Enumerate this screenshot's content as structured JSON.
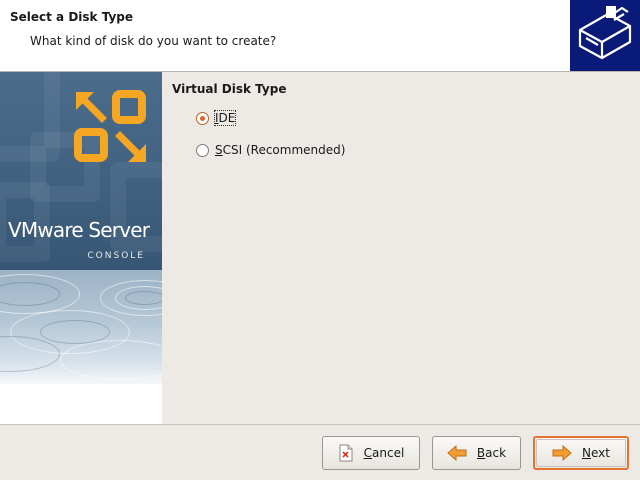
{
  "header": {
    "title": "Select a Disk Type",
    "subtitle": "What kind of disk do you want to create?",
    "logo_icon": "disk-drive-icon",
    "logo_bg": "#0a1a78"
  },
  "sidebar": {
    "brand_name": "VMware Server",
    "brand_sub": "CONSOLE",
    "logo_icon": "vmware-logo-icon",
    "accent": "#f5a623"
  },
  "section": {
    "label": "Virtual Disk Type"
  },
  "options": [
    {
      "mnemonic": "I",
      "rest": "DE",
      "checked": true
    },
    {
      "mnemonic": "S",
      "rest": "CSI (Recommended)",
      "checked": false
    }
  ],
  "buttons": {
    "cancel": {
      "mnemonic": "C",
      "rest": "ancel",
      "icon": "cancel-document-icon"
    },
    "back": {
      "mnemonic": "B",
      "rest": "ack",
      "icon": "arrow-left-icon"
    },
    "next": {
      "mnemonic": "N",
      "rest": "ext",
      "icon": "arrow-right-icon"
    }
  },
  "colors": {
    "selection": "#e0652b",
    "default_button_border": "#e2742f",
    "arrow": "#f39c32"
  }
}
